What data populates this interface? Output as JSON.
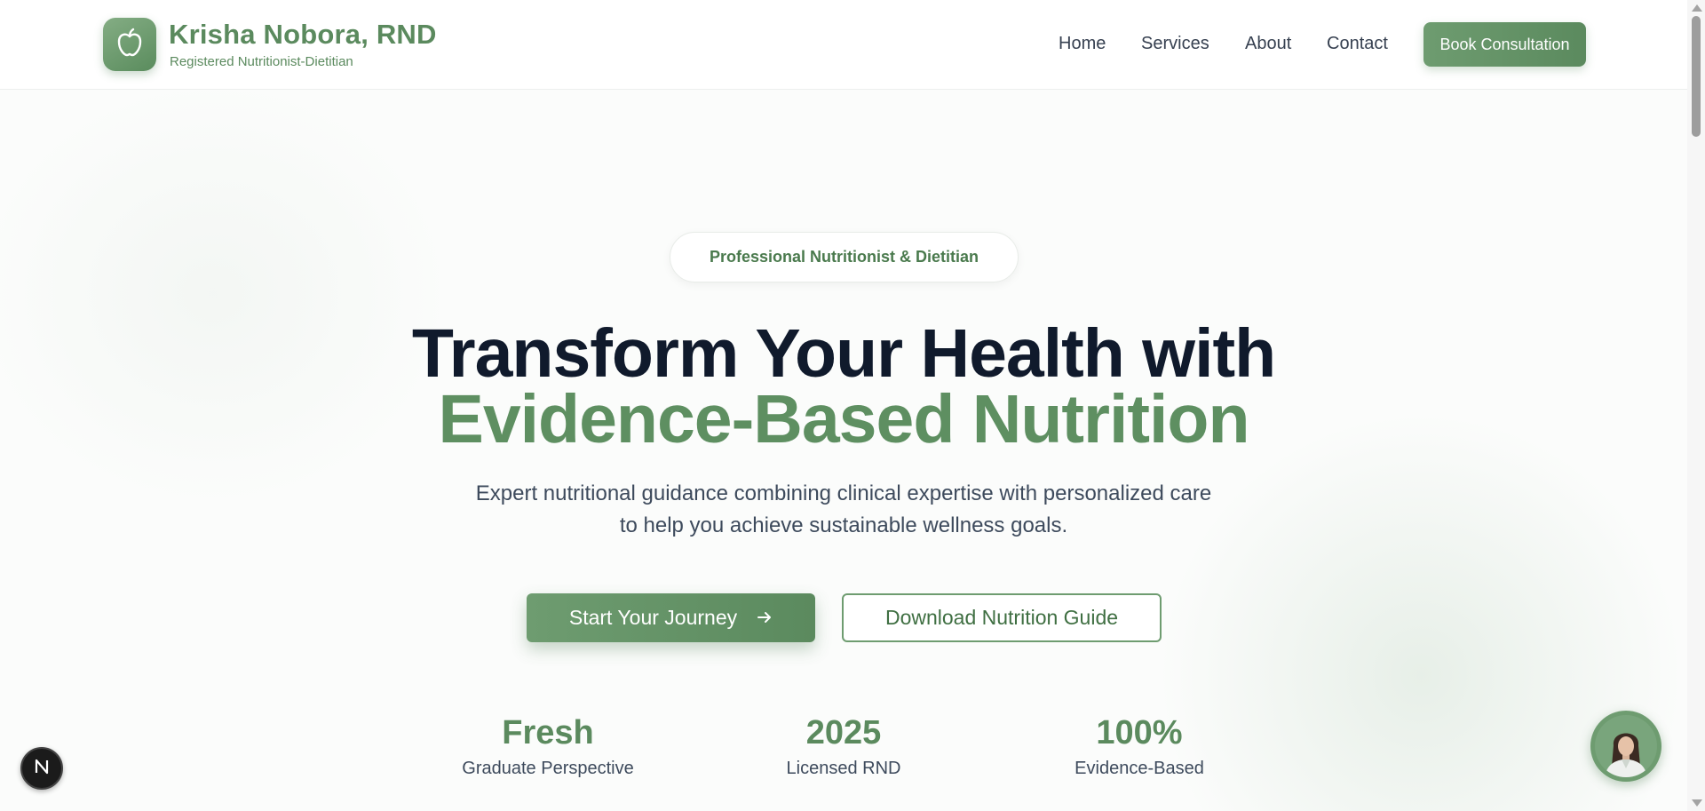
{
  "header": {
    "brand_name": "Krisha Nobora, RND",
    "brand_subtitle": "Registered Nutritionist-Dietitian",
    "logo_icon": "apple-icon",
    "nav": {
      "home": "Home",
      "services": "Services",
      "about": "About",
      "contact": "Contact"
    },
    "cta_label": "Book Consultation"
  },
  "hero": {
    "badge": "Professional Nutritionist & Dietitian",
    "title_line1": "Transform Your Health with",
    "title_line2": "Evidence-Based Nutrition",
    "lead": "Expert nutritional guidance combining clinical expertise with personalized care to help you achieve sustainable wellness goals.",
    "primary_button": "Start Your Journey",
    "primary_button_icon": "arrow-right-icon",
    "secondary_button": "Download Nutrition Guide"
  },
  "stats": [
    {
      "value": "Fresh",
      "label": "Graduate Perspective"
    },
    {
      "value": "2025",
      "label": "Licensed RND"
    },
    {
      "value": "100%",
      "label": "Evidence-Based"
    }
  ],
  "floating": {
    "dev_badge_letter": "N",
    "avatar_icon": "profile-photo"
  },
  "colors": {
    "brand_green": "#5b8a5e",
    "heading_dark": "#101a2c",
    "text_body": "#3d4a5c"
  }
}
